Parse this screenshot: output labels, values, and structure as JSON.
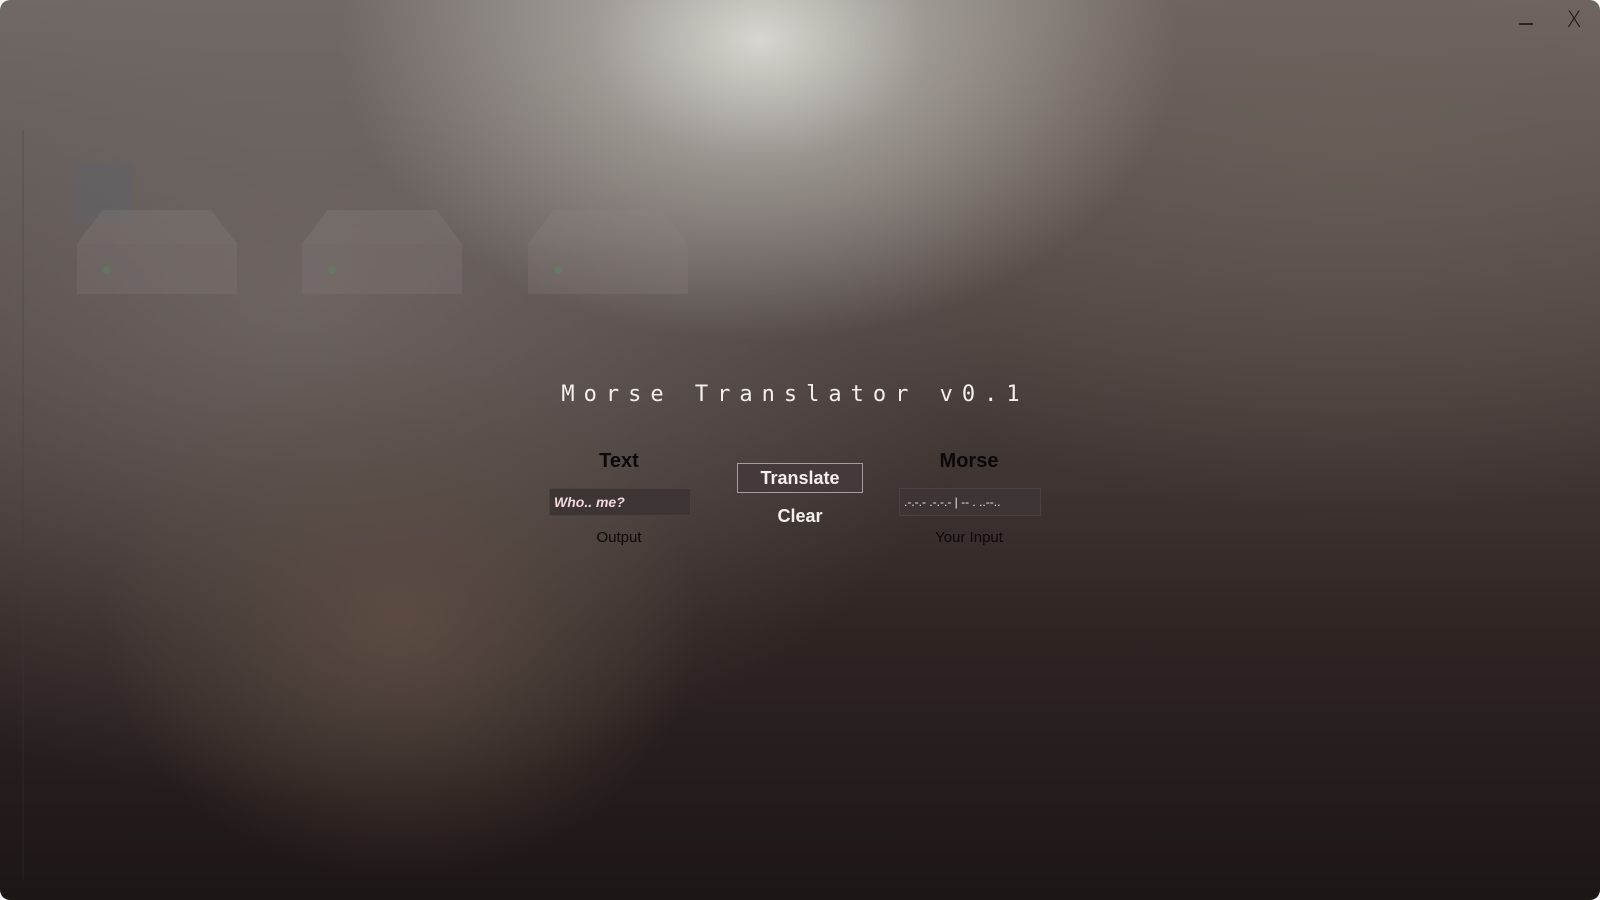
{
  "window": {
    "close_label": "X"
  },
  "app": {
    "title": "Morse Translator v0.1",
    "text_column": {
      "heading": "Text",
      "field_value": "Who.. me?",
      "sublabel": "Output"
    },
    "morse_column": {
      "heading": "Morse",
      "field_value": ".-.-.- .-.-.- | -- . ..--..",
      "sublabel": "Your Input"
    },
    "translate_label": "Translate",
    "clear_label": "Clear"
  },
  "icons": {
    "minimize": "minimize-icon",
    "close": "close-icon"
  },
  "colors": {
    "field_bg": "#3d3434",
    "field_text": "#f2d6d8",
    "title_text": "#f2efec"
  }
}
